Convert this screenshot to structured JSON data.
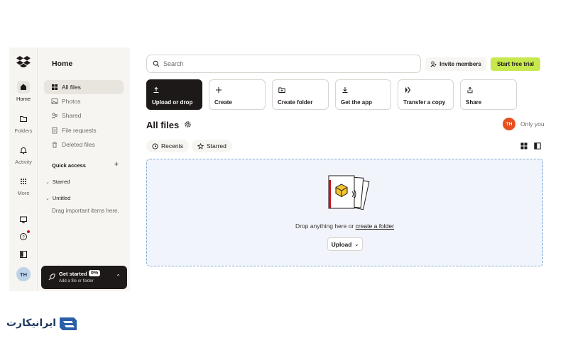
{
  "rail": {
    "items": [
      {
        "label": "Home",
        "icon": "home-icon"
      },
      {
        "label": "Folders",
        "icon": "folder-icon"
      },
      {
        "label": "Activity",
        "icon": "bell-icon"
      },
      {
        "label": "More",
        "icon": "grid-icon"
      }
    ],
    "avatar": "TH"
  },
  "panel": {
    "title": "Home",
    "nav": [
      {
        "label": "All files",
        "icon": "files-icon"
      },
      {
        "label": "Photos",
        "icon": "photo-icon"
      },
      {
        "label": "Shared",
        "icon": "shared-icon"
      },
      {
        "label": "File requests",
        "icon": "file-request-icon"
      },
      {
        "label": "Deleted files",
        "icon": "trash-icon"
      }
    ],
    "quick_access": "Quick access",
    "starred": "Starred",
    "untitled": "Untitled",
    "hint": "Drag important items here.",
    "get_started": {
      "title": "Get started",
      "percent": "0%",
      "subtitle": "Add a file or folder"
    }
  },
  "search": {
    "placeholder": "Search"
  },
  "header": {
    "invite": "Invite members",
    "trial": "Start free trial"
  },
  "quick_actions": [
    {
      "label": "Upload or drop",
      "icon": "upload-icon"
    },
    {
      "label": "Create",
      "icon": "plus-icon"
    },
    {
      "label": "Create folder",
      "icon": "folder-plus-icon"
    },
    {
      "label": "Get the app",
      "icon": "download-icon"
    },
    {
      "label": "Transfer a copy",
      "icon": "transfer-icon"
    },
    {
      "label": "Share",
      "icon": "share-icon"
    }
  ],
  "main": {
    "title": "All files",
    "owner_initials": "TH",
    "owner_label": "Only you",
    "chips": [
      "Recents",
      "Starred"
    ],
    "drop_text": "Drop anything here or",
    "drop_link": "create a folder",
    "upload": "Upload"
  },
  "watermark": {
    "text": "ایرانیکارت"
  },
  "colors": {
    "accent_trial": "#c7e84e",
    "owner_badge": "#e8501f",
    "dropzone_border": "#7aa9d6"
  }
}
